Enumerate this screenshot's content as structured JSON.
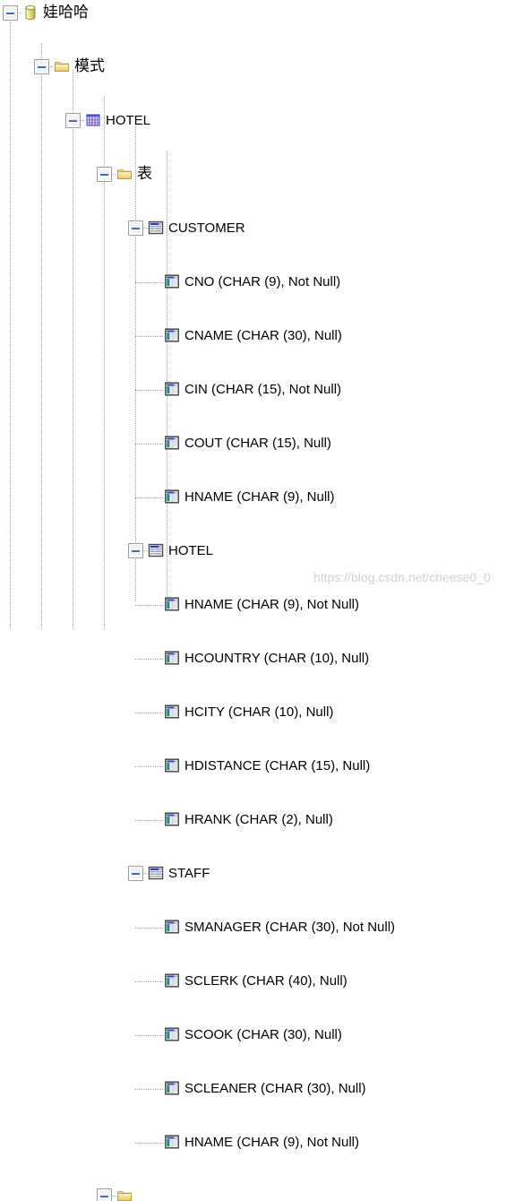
{
  "tree": {
    "nodes": [
      {
        "id": "db",
        "label": "娃哈哈",
        "icon": "database-icon",
        "depth": 0,
        "expanded": true,
        "cjk": true,
        "leaf": false
      },
      {
        "id": "schemas",
        "label": "模式",
        "icon": "folder-icon",
        "depth": 1,
        "expanded": true,
        "cjk": true,
        "leaf": false
      },
      {
        "id": "hotel-sch",
        "label": "HOTEL",
        "icon": "schema-icon",
        "depth": 2,
        "expanded": true,
        "cjk": false,
        "leaf": false
      },
      {
        "id": "tables",
        "label": "表",
        "icon": "folder-icon",
        "depth": 3,
        "expanded": true,
        "cjk": true,
        "leaf": false
      },
      {
        "id": "t-customer",
        "label": "CUSTOMER",
        "icon": "table-icon",
        "depth": 4,
        "expanded": true,
        "cjk": false,
        "leaf": false
      },
      {
        "id": "c1",
        "label": "CNO (CHAR (9), Not Null)",
        "icon": "column-icon",
        "depth": 5,
        "expanded": null,
        "cjk": false,
        "leaf": true
      },
      {
        "id": "c2",
        "label": "CNAME (CHAR (30), Null)",
        "icon": "column-icon",
        "depth": 5,
        "expanded": null,
        "cjk": false,
        "leaf": true
      },
      {
        "id": "c3",
        "label": "CIN (CHAR (15), Not Null)",
        "icon": "column-icon",
        "depth": 5,
        "expanded": null,
        "cjk": false,
        "leaf": true
      },
      {
        "id": "c4",
        "label": "COUT (CHAR (15), Null)",
        "icon": "column-icon",
        "depth": 5,
        "expanded": null,
        "cjk": false,
        "leaf": true
      },
      {
        "id": "c5",
        "label": "HNAME (CHAR (9), Null)",
        "icon": "column-icon",
        "depth": 5,
        "expanded": null,
        "cjk": false,
        "leaf": true
      },
      {
        "id": "t-hotel",
        "label": "HOTEL",
        "icon": "table-icon",
        "depth": 4,
        "expanded": true,
        "cjk": false,
        "leaf": false
      },
      {
        "id": "h1",
        "label": "HNAME (CHAR (9), Not Null)",
        "icon": "column-icon",
        "depth": 5,
        "expanded": null,
        "cjk": false,
        "leaf": true
      },
      {
        "id": "h2",
        "label": "HCOUNTRY (CHAR (10), Null)",
        "icon": "column-icon",
        "depth": 5,
        "expanded": null,
        "cjk": false,
        "leaf": true
      },
      {
        "id": "h3",
        "label": "HCITY (CHAR (10), Null)",
        "icon": "column-icon",
        "depth": 5,
        "expanded": null,
        "cjk": false,
        "leaf": true
      },
      {
        "id": "h4",
        "label": "HDISTANCE (CHAR (15), Null)",
        "icon": "column-icon",
        "depth": 5,
        "expanded": null,
        "cjk": false,
        "leaf": true
      },
      {
        "id": "h5",
        "label": "HRANK (CHAR (2), Null)",
        "icon": "column-icon",
        "depth": 5,
        "expanded": null,
        "cjk": false,
        "leaf": true
      },
      {
        "id": "t-staff",
        "label": "STAFF",
        "icon": "table-icon",
        "depth": 4,
        "expanded": true,
        "cjk": false,
        "leaf": false
      },
      {
        "id": "s1",
        "label": "SMANAGER (CHAR (30), Not Null)",
        "icon": "column-icon",
        "depth": 5,
        "expanded": null,
        "cjk": false,
        "leaf": true
      },
      {
        "id": "s2",
        "label": "SCLERK (CHAR (40), Null)",
        "icon": "column-icon",
        "depth": 5,
        "expanded": null,
        "cjk": false,
        "leaf": true
      },
      {
        "id": "s3",
        "label": "SCOOK (CHAR (30), Null)",
        "icon": "column-icon",
        "depth": 5,
        "expanded": null,
        "cjk": false,
        "leaf": true
      },
      {
        "id": "s4",
        "label": "SCLEANER (CHAR (30), Null)",
        "icon": "column-icon",
        "depth": 5,
        "expanded": null,
        "cjk": false,
        "leaf": true
      },
      {
        "id": "s5",
        "label": "HNAME (CHAR (9), Not Null)",
        "icon": "column-icon",
        "depth": 5,
        "expanded": null,
        "cjk": false,
        "leaf": true
      },
      {
        "id": "views",
        "label": "",
        "icon": "folder-icon",
        "depth": 3,
        "expanded": true,
        "cjk": true,
        "leaf": false
      }
    ]
  },
  "watermark": {
    "text": "https://blog.csdn.net/cheese0_0"
  },
  "colors": {
    "expander_border": "#9b9b9b",
    "expander_fill": "#f3f3f3",
    "expander_sign": "#3b6fb6",
    "guide_line": "#9a9a9a",
    "folder": "#f2d98c",
    "database": "#d8d86a",
    "table_header": "#2a3fb8",
    "column_accent": "#2f8a8a",
    "text": "#000000",
    "watermark": "#c9c9c9"
  }
}
